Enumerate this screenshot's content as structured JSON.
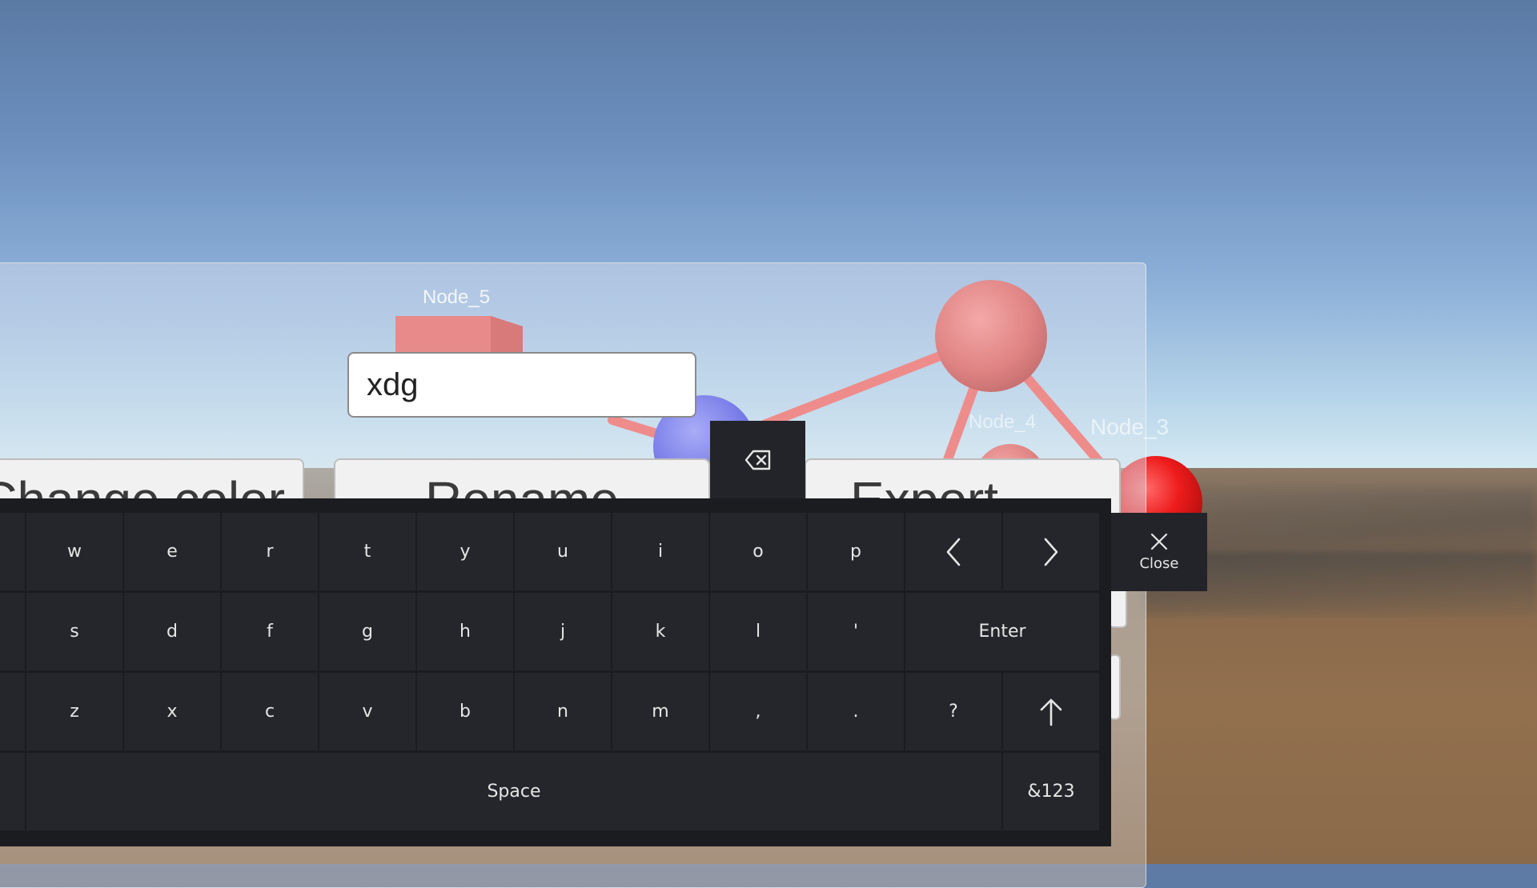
{
  "scene": {
    "node_labels": [
      "Node_5",
      "Node_4",
      "Node_3"
    ]
  },
  "editor": {
    "text_input_value": "xdg",
    "buttons": {
      "change_color": "Change color",
      "rename": "Rename",
      "export": "Export"
    }
  },
  "keyboard": {
    "row1": [
      "w",
      "e",
      "r",
      "t",
      "y",
      "u",
      "i",
      "o",
      "p"
    ],
    "row2": [
      "s",
      "d",
      "f",
      "g",
      "h",
      "j",
      "k",
      "l",
      "'"
    ],
    "row3": [
      "z",
      "x",
      "c",
      "v",
      "b",
      "n",
      "m",
      ",",
      ".",
      "?"
    ],
    "enter_label": "Enter",
    "space_label": "Space",
    "symbols_label": "&123",
    "close_label": "Close",
    "icons": {
      "backspace": "backspace-icon",
      "left": "chevron-left-icon",
      "right": "chevron-right-icon",
      "shift": "shift-arrow-up-icon",
      "close": "close-icon"
    }
  },
  "colors": {
    "keyboard_bg": "#1b1c20",
    "key_bg": "#25262b",
    "key_text": "#e6e6e6",
    "node_blue": "#7a7ee8",
    "node_pink": "#e88686",
    "node_red": "#ee1c1c"
  }
}
